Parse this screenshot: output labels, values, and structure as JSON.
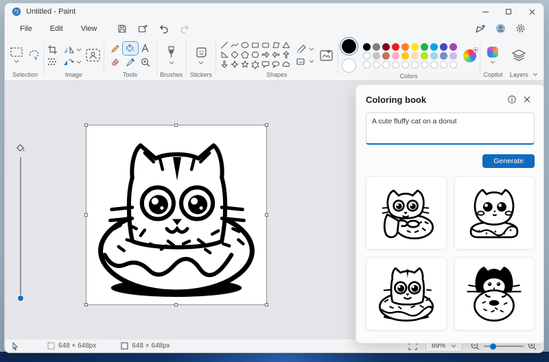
{
  "window": {
    "title": "Untitled - Paint"
  },
  "menu": {
    "items": [
      "File",
      "Edit",
      "View"
    ]
  },
  "ribbon": {
    "labels": {
      "selection": "Selection",
      "image": "Image",
      "tools": "Tools",
      "brushes": "Brushes",
      "stickers": "Stickers",
      "shapes": "Shapes",
      "colors": "Colors",
      "copilot": "Copilot",
      "layers": "Layers"
    },
    "shapes": [
      "line",
      "curve",
      "oval",
      "rectangle",
      "rounded-rectangle",
      "quadrilateral",
      "triangle",
      "right-triangle",
      "diamond",
      "pentagon",
      "hexagon",
      "arrow-right",
      "arrow-left",
      "arrow-up",
      "arrow-down",
      "four-point-star",
      "five-point-star",
      "six-point-star",
      "speech-bubble",
      "oval-callout",
      "cloud"
    ]
  },
  "palette": {
    "primary": "#000000",
    "secondary": "#ffffff",
    "row1": [
      "#000000",
      "#7f7f7f",
      "#880015",
      "#ed1c24",
      "#ff7f27",
      "#ffe21f",
      "#22b14c",
      "#00a2e8",
      "#3f48cc",
      "#a349a4"
    ],
    "row2": [
      "#ffffff",
      "#c3c3c3",
      "#b97a57",
      "#ffaec9",
      "#ffc90e",
      "#efe4b0",
      "#b5e61d",
      "#99d9ea",
      "#7092be",
      "#c8bfe7"
    ],
    "empty_count": 10,
    "accent": "#0f6cbd"
  },
  "panel": {
    "title": "Coloring book",
    "prompt": "A cute fluffy cat on a donut",
    "generate": "Generate",
    "thumbnails": [
      {
        "label": "Cat hugging a donut"
      },
      {
        "label": "Fluffy round cat sitting on a donut"
      },
      {
        "label": "Cat head inside a donut"
      },
      {
        "label": "Black and white cat behind a donut"
      }
    ]
  },
  "canvas": {
    "alt": "Line art of a cute cat sitting in a sprinkled donut"
  },
  "status": {
    "selection_size": "648 × 648px",
    "canvas_size": "648 × 648px",
    "zoom": "69%"
  }
}
